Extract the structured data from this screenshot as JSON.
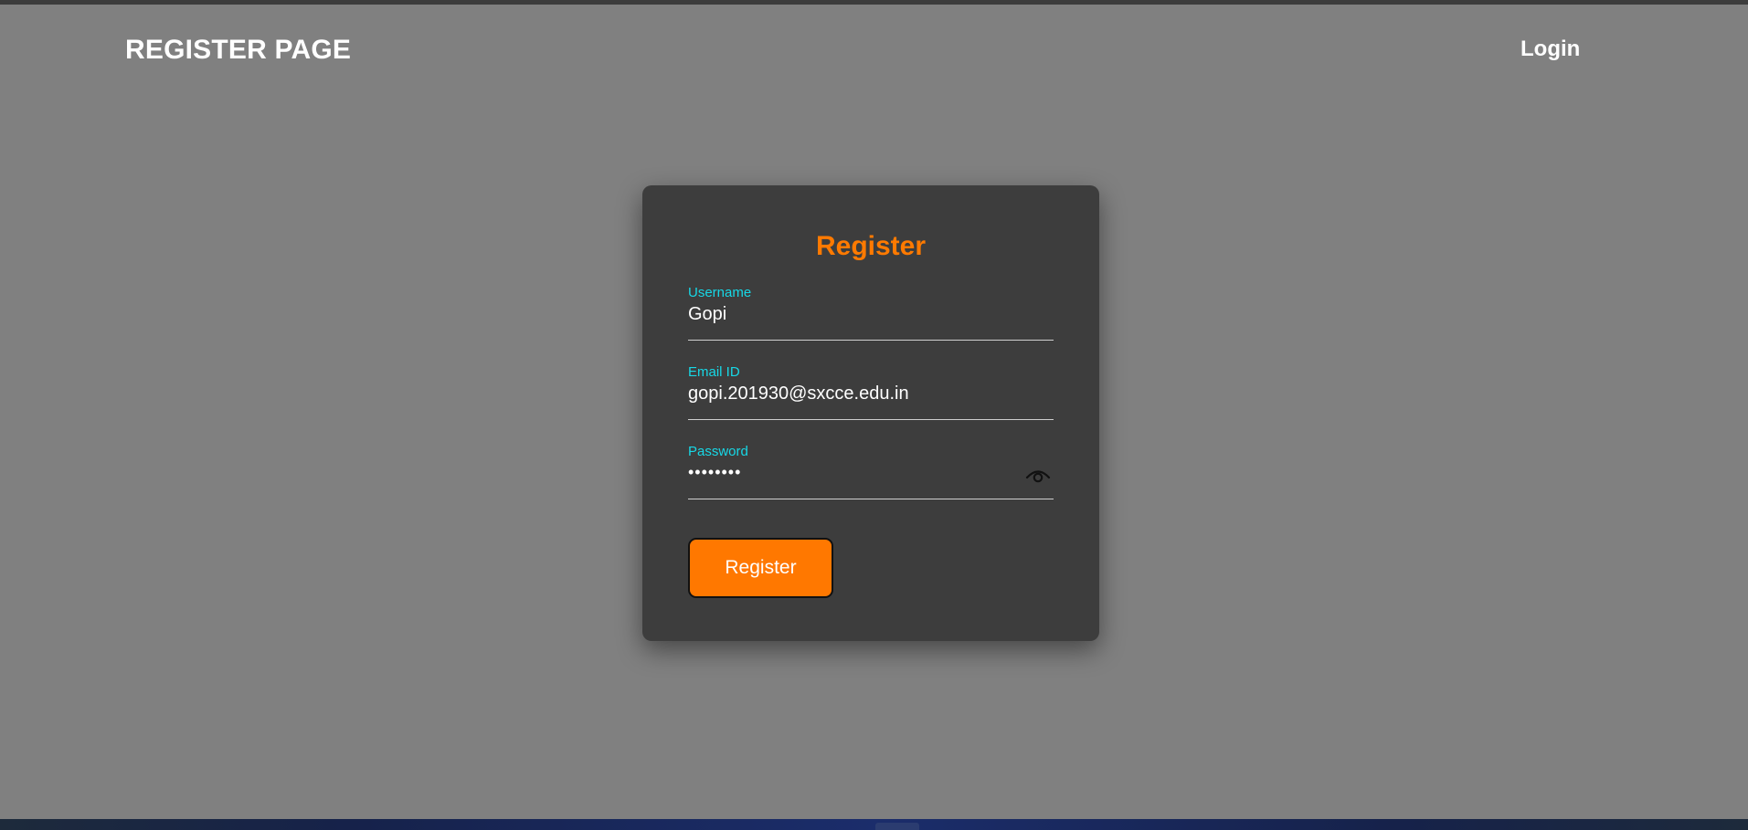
{
  "header": {
    "brand": "REGISTER PAGE",
    "login_link": "Login"
  },
  "form": {
    "title": "Register",
    "username": {
      "label": "Username",
      "value": "Gopi"
    },
    "email": {
      "label": "Email ID",
      "value": "gopi.201930@sxcce.edu.in"
    },
    "password": {
      "label": "Password",
      "masked_value": "••••••••",
      "toggle_icon": "eye-icon"
    },
    "submit_label": "Register"
  },
  "colors": {
    "page_background": "#808080",
    "card_background": "#3d3d3d",
    "accent": "#ff7800",
    "title_accent": "#ff7a00",
    "label_color": "#17d8e6",
    "text_color": "#ffffff"
  }
}
